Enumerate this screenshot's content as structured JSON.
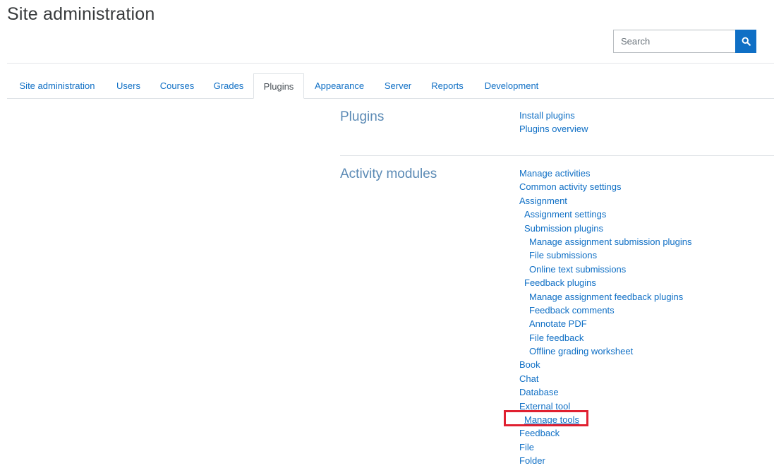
{
  "page": {
    "title": "Site administration"
  },
  "search": {
    "placeholder": "Search",
    "icon": "search-icon"
  },
  "tabs": [
    {
      "label": "Site administration",
      "active": false
    },
    {
      "label": "Users",
      "active": false
    },
    {
      "label": "Courses",
      "active": false
    },
    {
      "label": "Grades",
      "active": false
    },
    {
      "label": "Plugins",
      "active": true
    },
    {
      "label": "Appearance",
      "active": false
    },
    {
      "label": "Server",
      "active": false
    },
    {
      "label": "Reports",
      "active": false
    },
    {
      "label": "Development",
      "active": false
    }
  ],
  "sections": [
    {
      "title": "Plugins",
      "links": [
        {
          "label": "Install plugins",
          "level": 0
        },
        {
          "label": "Plugins overview",
          "level": 0
        }
      ]
    },
    {
      "title": "Activity modules",
      "links": [
        {
          "label": "Manage activities",
          "level": 0
        },
        {
          "label": "Common activity settings",
          "level": 0
        },
        {
          "label": "Assignment",
          "level": 0
        },
        {
          "label": "Assignment settings",
          "level": 1
        },
        {
          "label": "Submission plugins",
          "level": 1
        },
        {
          "label": "Manage assignment submission plugins",
          "level": 2
        },
        {
          "label": "File submissions",
          "level": 2
        },
        {
          "label": "Online text submissions",
          "level": 2
        },
        {
          "label": "Feedback plugins",
          "level": 1
        },
        {
          "label": "Manage assignment feedback plugins",
          "level": 2
        },
        {
          "label": "Feedback comments",
          "level": 2
        },
        {
          "label": "Annotate PDF",
          "level": 2
        },
        {
          "label": "File feedback",
          "level": 2
        },
        {
          "label": "Offline grading worksheet",
          "level": 2
        },
        {
          "label": "Book",
          "level": 0
        },
        {
          "label": "Chat",
          "level": 0
        },
        {
          "label": "Database",
          "level": 0
        },
        {
          "label": "External tool",
          "level": 0
        },
        {
          "label": "Manage tools",
          "level": 1,
          "highlighted": true
        },
        {
          "label": "Feedback",
          "level": 0
        },
        {
          "label": "File",
          "level": 0
        },
        {
          "label": "Folder",
          "level": 0
        }
      ]
    }
  ],
  "colors": {
    "link": "#0f6fc5",
    "search_button": "#0f6fc5",
    "highlight_border": "#e02030",
    "section_title": "#5b8ab5"
  }
}
